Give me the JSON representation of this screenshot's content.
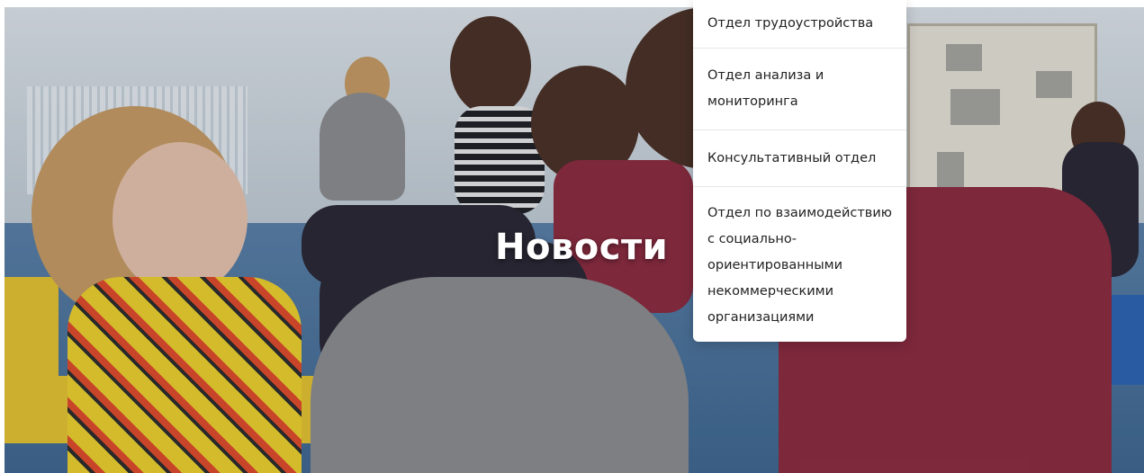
{
  "hero": {
    "title": "Новости",
    "background_image": "sports-hall-girls-situps-photo"
  },
  "dropdown": {
    "items": [
      {
        "label": "Отдел трудоустройства"
      },
      {
        "label": "Отдел анализа и мониторинга"
      },
      {
        "label": "Консультативный отдел"
      },
      {
        "label": "Отдел по взаимодействию с социально-ориентированными некоммерческими организациями"
      }
    ]
  },
  "colors": {
    "title_text": "#ffffff",
    "menu_background": "#ffffff",
    "menu_text": "#222222",
    "menu_divider": "#e7e7e7"
  }
}
